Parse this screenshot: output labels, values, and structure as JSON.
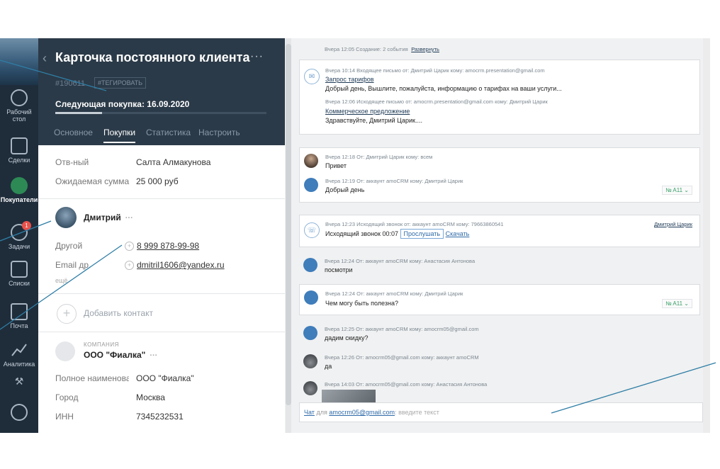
{
  "nav": {
    "items": [
      {
        "label": "Рабочий стол",
        "label2": "стол",
        "label1": "Рабочий"
      },
      {
        "label": "Сделки"
      },
      {
        "label": "Покупатели"
      },
      {
        "label": "Задачи",
        "badge": "1"
      },
      {
        "label": "Списки"
      },
      {
        "label": "Почта"
      },
      {
        "label": "Аналитика"
      }
    ]
  },
  "card": {
    "title": "Карточка постоянного клиента",
    "menu": "···",
    "id": "#190611",
    "tag_button": "#ТЕГИРОВАТЬ",
    "next_purchase": "Следующая покупка: 16.09.2020",
    "progress": 0.22,
    "tabs": [
      "Основное",
      "Покупки",
      "Статистика",
      "Настроить"
    ],
    "active_tab": "Покупки",
    "fields": [
      {
        "label": "Отв-ный",
        "value": "Салта Алмакунова"
      },
      {
        "label": "Ожидаемая сумма",
        "value": "25 000 руб"
      }
    ],
    "contact": {
      "name": "Дмитрий",
      "dots": "···",
      "phone_label": "Другой",
      "phone": "8 999 878-99-98",
      "email_label": "Email др.",
      "email": "dmitril1606@yandex.ru",
      "more": "ещё"
    },
    "add_contact": "Добавить контакт",
    "company": {
      "caption": "КОМПАНИЯ",
      "name": "ООО \"Фиалка\"",
      "dots": "···",
      "fields": [
        {
          "label": "Полное наименова",
          "value": "ООО \"Фиалка\""
        },
        {
          "label": "Город",
          "value": "Москва"
        },
        {
          "label": "ИНН",
          "value": "7345232531"
        }
      ]
    }
  },
  "feed": {
    "top_meta": "Вчера 12:05 Создание: 2 события",
    "top_link": "Развернуть",
    "email": {
      "meta1": "Вчера 10:14 Входящее письмо от: Дмитрий Царик кому: amocrm.presentation@gmail.com",
      "subject1": "Запрос тарифов",
      "body1": "Добрый день, Вышлите, пожалуйста, информацию о тарифах на ваши услуги...",
      "meta2": "Вчера 12:06 Исходящее письмо от: amocrm.presentation@gmail.com кому: Дмитрий Царик",
      "subject2": "Коммерческое предложение",
      "body2": "Здравствуйте, Дмитрий Царик...."
    },
    "chat1": {
      "meta1": "Вчера 12:18 От: Дмитрий Царик кому: всем",
      "text1": "Привет",
      "meta2": "Вчера 12:19 От: аккаунт amoCRM кому: Дмитрий Царик",
      "text2": "Добрый день",
      "chip": "№ A11 ⌄"
    },
    "call": {
      "meta": "Вчера 12:23 Исходящий звонок от: аккаунт amoCRM  кому: 79663860541",
      "who": "Дмитрий Царик",
      "text": "Исходящий звонок 00:07",
      "listen": "Прослушать",
      "download": "Скачать"
    },
    "m1": {
      "meta": "Вчера 12:24 От: аккаунт amoCRM кому: Анастасия Антонова",
      "text": "посмотри"
    },
    "m2": {
      "meta": "Вчера 12:24 От: аккаунт amoCRM кому: Дмитрий Царик",
      "text": "Чем могу быть полезна?",
      "chip": "№ A11 ⌄"
    },
    "m3": {
      "meta": "Вчера 12:25 От: аккаунт amoCRM кому: amocrm05@gmail.com",
      "text": "дадим скидку?"
    },
    "m4": {
      "meta": "Вчера 12:26 От: amocrm05@gmail.com кому: аккаунт amoCRM",
      "text": "да"
    },
    "m5": {
      "meta": "Вчера 14:03 От: amocrm05@gmail.com кому: Анастасия Антонова"
    },
    "input": {
      "chat": "Чат",
      "for": "для",
      "recipient": "amocrm05@gmail.com",
      "placeholder": "введите текст"
    }
  },
  "colors": {
    "nav_bg": "#1f2d3b",
    "card_header": "#2b3a48",
    "feed_bg": "#f0f1f2",
    "accent_line": "#2f7ea6"
  }
}
